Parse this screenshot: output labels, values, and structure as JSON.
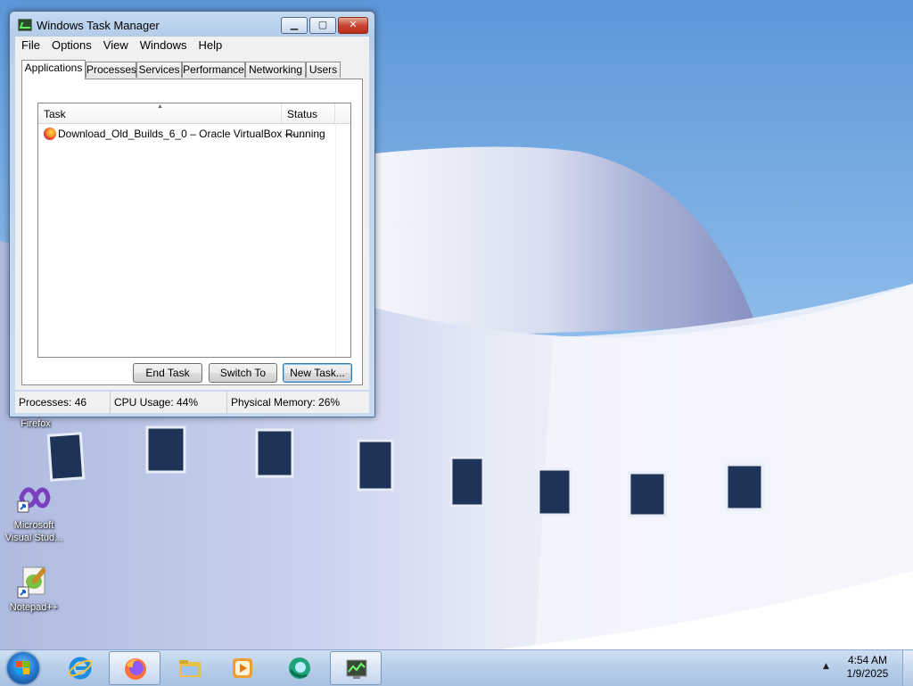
{
  "desktop": {
    "icons": [
      {
        "label": "Firefox"
      },
      {
        "label": "Microsoft Visual Stud..."
      },
      {
        "label": "Notepad++"
      }
    ]
  },
  "task_manager": {
    "title": "Windows Task Manager",
    "controls": {
      "minimize": "▁",
      "maximize": "▢",
      "close": "✕"
    },
    "menu": [
      "File",
      "Options",
      "View",
      "Windows",
      "Help"
    ],
    "tabs": [
      "Applications",
      "Processes",
      "Services",
      "Performance",
      "Networking",
      "Users"
    ],
    "active_tab": "Applications",
    "columns": {
      "task": "Task",
      "status": "Status"
    },
    "rows": [
      {
        "task": "Download_Old_Builds_6_0 – Oracle VirtualBox —...",
        "status": "Running"
      }
    ],
    "buttons": {
      "end_task": "End Task",
      "switch_to": "Switch To",
      "new_task": "New Task..."
    },
    "statusbar": {
      "processes": "Processes: 46",
      "cpu": "CPU Usage: 44%",
      "memory": "Physical Memory: 26%"
    }
  },
  "taskbar": {
    "items": [
      "start-orb",
      "internet-explorer-icon",
      "firefox-icon",
      "file-explorer-icon",
      "media-player-icon",
      "app-icon",
      "task-manager-icon"
    ],
    "active": "firefox-icon",
    "clock": {
      "time": "4:54 AM",
      "date": "1/9/2025"
    }
  },
  "colors": {
    "taskbar": "#b9cfe9",
    "window_frame": "#c4d9f1",
    "close_button": "#c6452f"
  }
}
